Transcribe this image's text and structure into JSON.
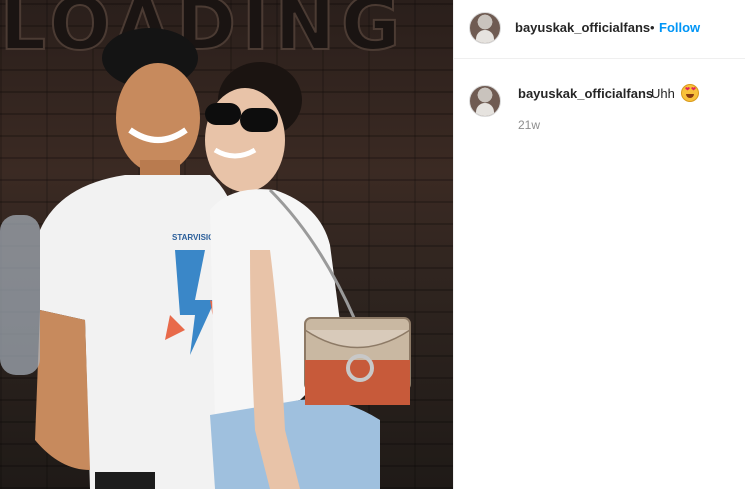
{
  "post": {
    "sign_text": "LOADING",
    "shirt_text": "STARVISION"
  },
  "header": {
    "username": "bayuskak_officialfans",
    "separator": "•",
    "follow_label": "Follow"
  },
  "comments": [
    {
      "username": "bayuskak_officialfans",
      "text": "Uhh",
      "emoji": "heart-eyes-emoji-icon",
      "time": "21w"
    }
  ],
  "colors": {
    "follow_blue": "#0095f6",
    "text_primary": "#262626",
    "text_secondary": "#8e8e8e"
  }
}
